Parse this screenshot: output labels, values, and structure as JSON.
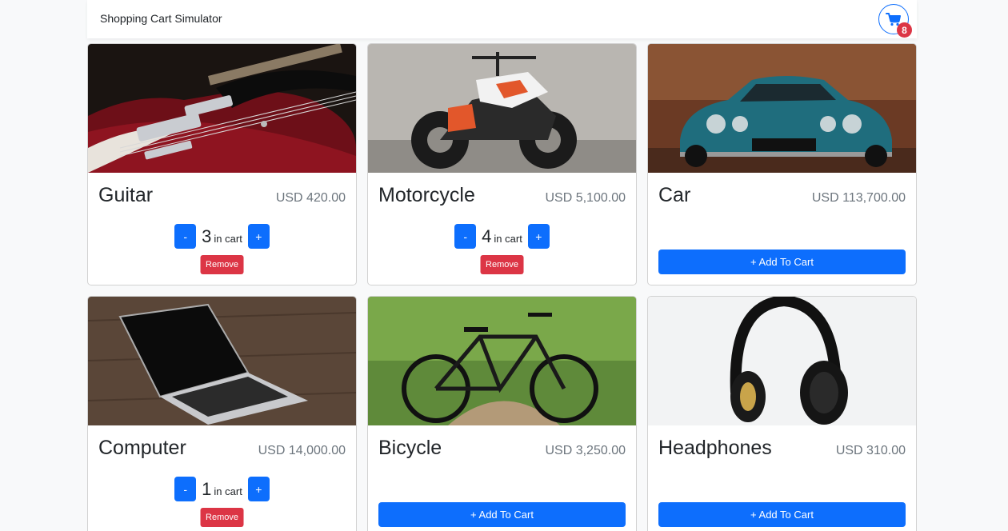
{
  "navbar": {
    "brand": "Shopping Cart Simulator",
    "cart_count": "8"
  },
  "colors": {
    "primary": "#0d6efd",
    "danger": "#dc3545",
    "muted": "#6c757d"
  },
  "products": [
    {
      "name": "Guitar",
      "price": "USD 420.00",
      "qty": "3",
      "qty_label": "in cart",
      "remove_label": "Remove",
      "minus": "-",
      "plus": "+"
    },
    {
      "name": "Motorcycle",
      "price": "USD 5,100.00",
      "qty": "4",
      "qty_label": "in cart",
      "remove_label": "Remove",
      "minus": "-",
      "plus": "+"
    },
    {
      "name": "Car",
      "price": "USD 113,700.00",
      "add_label": "+ Add To Cart"
    },
    {
      "name": "Computer",
      "price": "USD 14,000.00",
      "qty": "1",
      "qty_label": "in cart",
      "remove_label": "Remove",
      "minus": "-",
      "plus": "+"
    },
    {
      "name": "Bicycle",
      "price": "USD 3,250.00",
      "add_label": "+ Add To Cart"
    },
    {
      "name": "Headphones",
      "price": "USD 310.00",
      "add_label": "+ Add To Cart"
    }
  ]
}
